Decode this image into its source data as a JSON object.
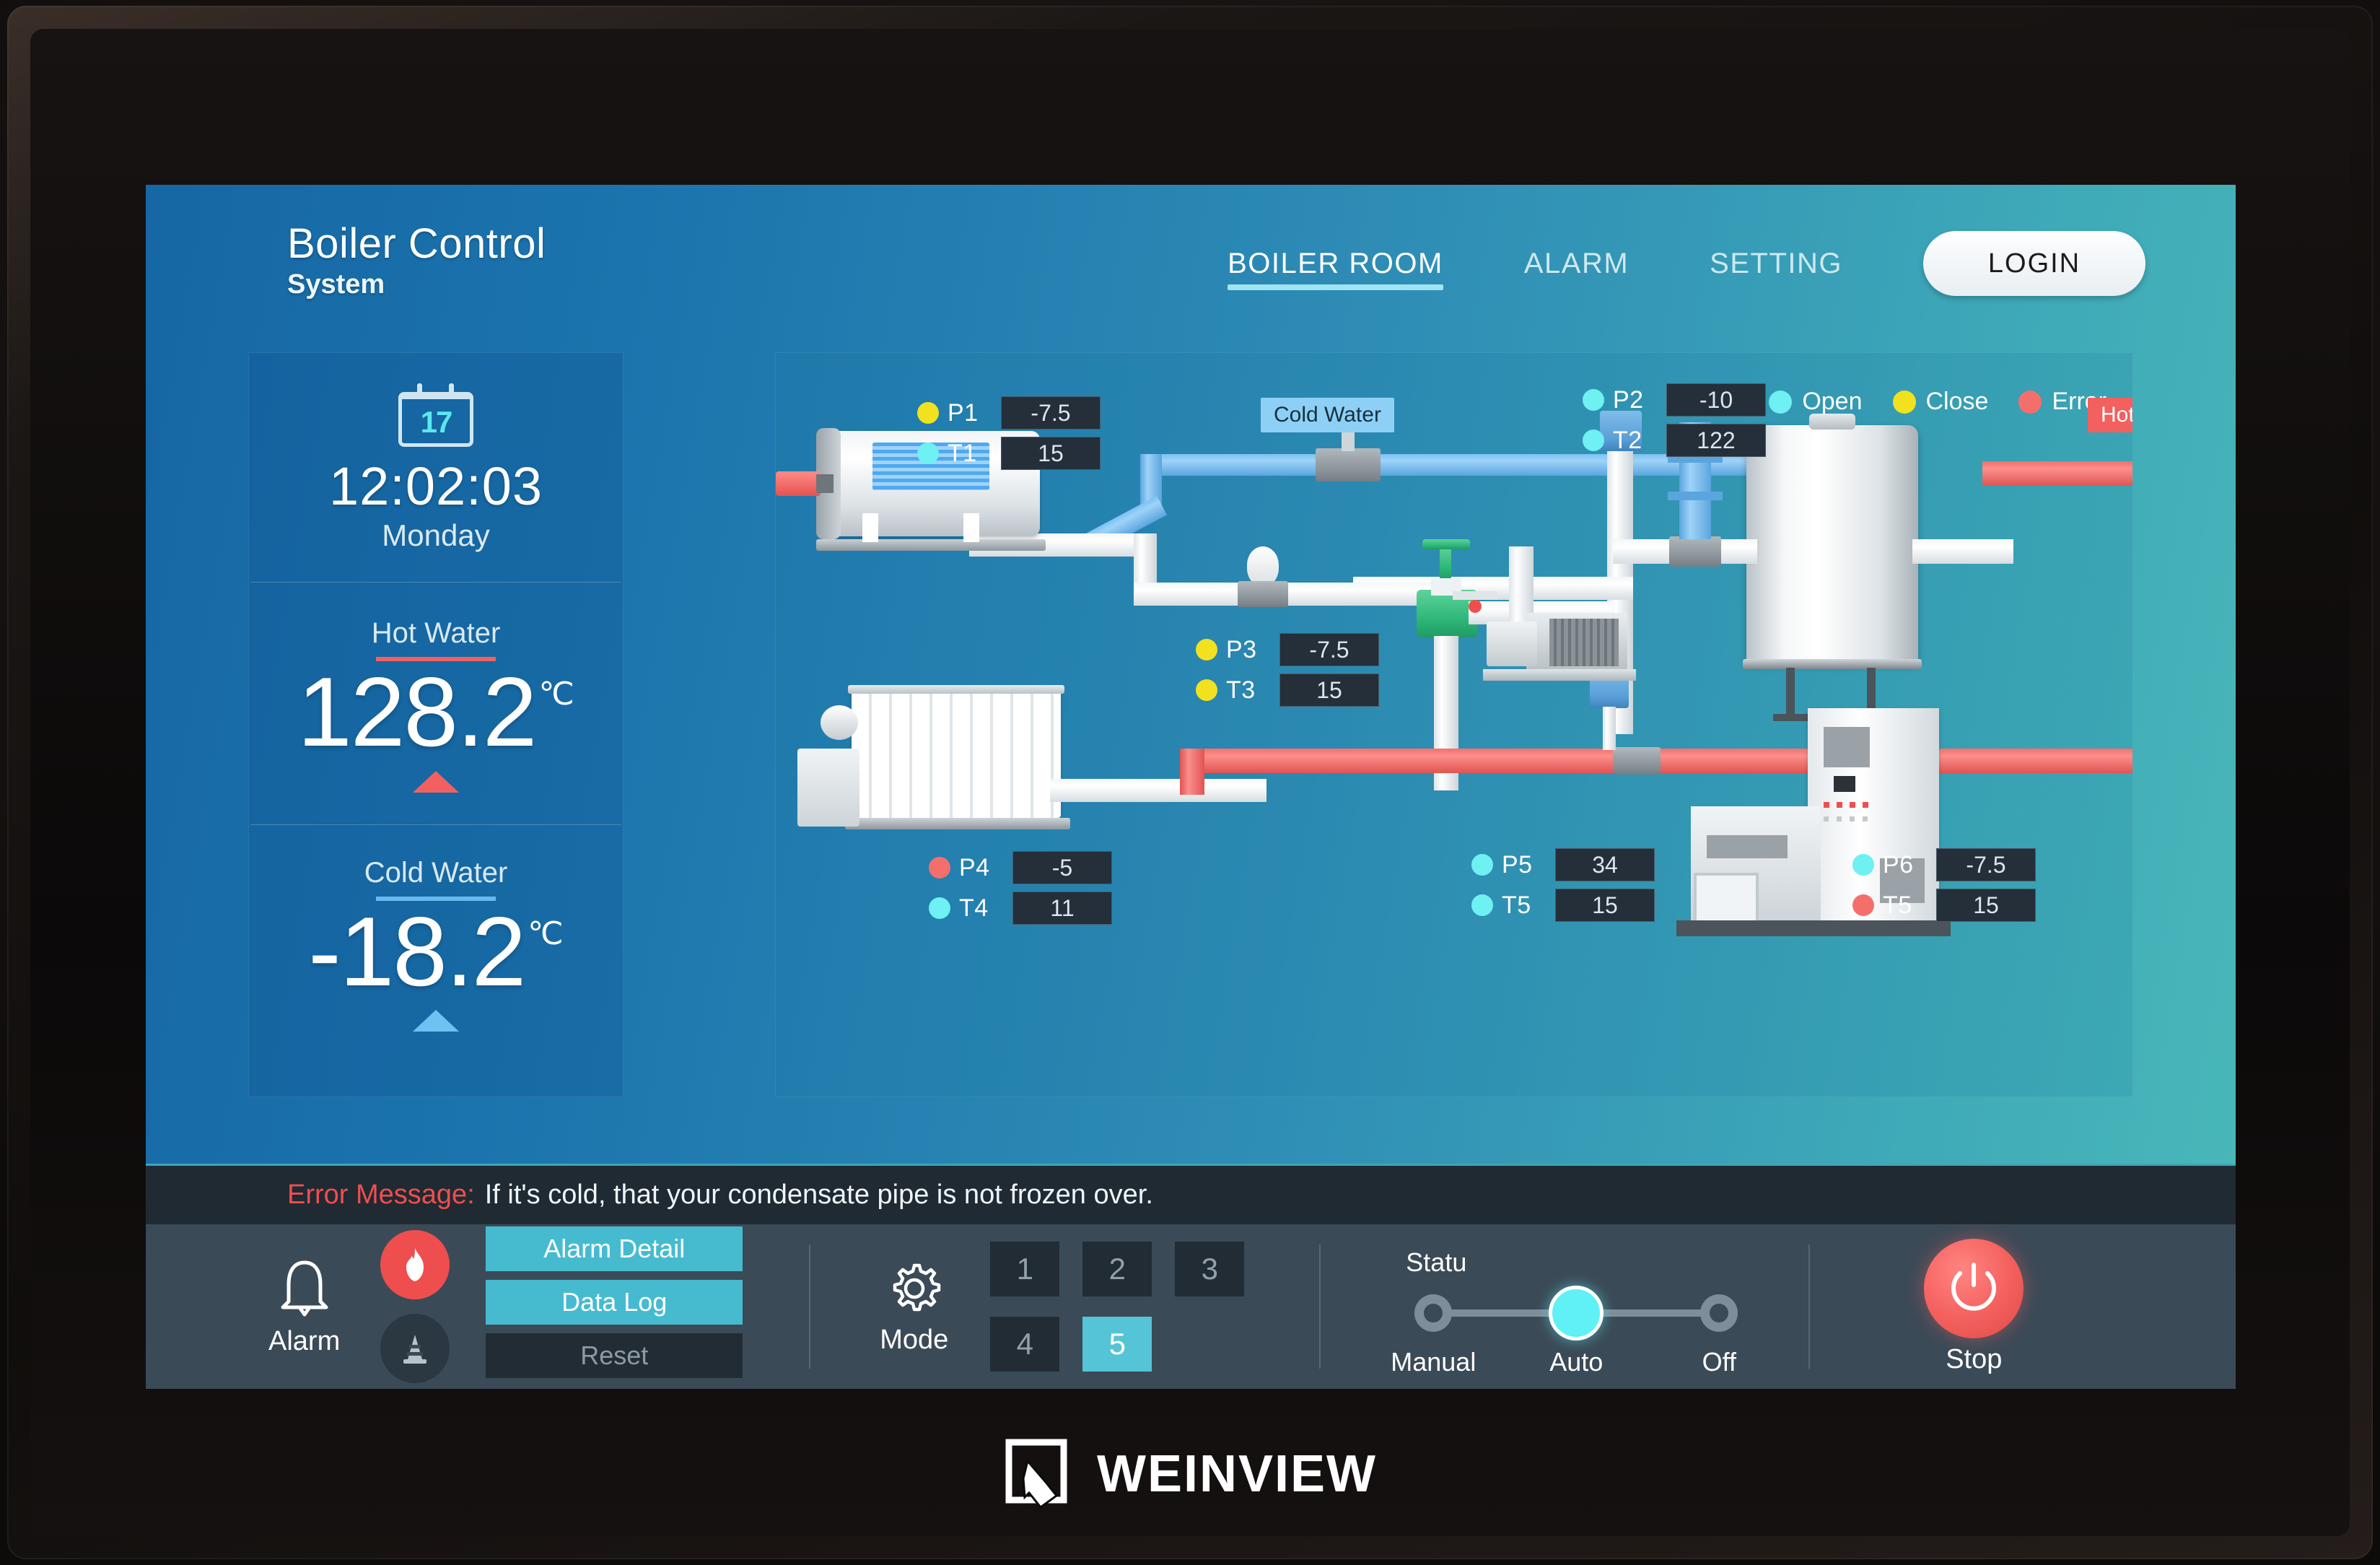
{
  "header": {
    "title": "Boiler Control",
    "subtitle": "System",
    "nav": [
      {
        "label": "BOILER ROOM",
        "active": true
      },
      {
        "label": "ALARM",
        "active": false
      },
      {
        "label": "SETTING",
        "active": false
      }
    ],
    "login_label": "LOGIN"
  },
  "sidebar": {
    "calendar_day": "17",
    "time": "12:02:03",
    "weekday": "Monday",
    "hot": {
      "label": "Hot Water",
      "value": "128.2",
      "unit": "℃",
      "trend": "up",
      "accent": "#f2615f"
    },
    "cold": {
      "label": "Cold Water",
      "value": "-18.2",
      "unit": "℃",
      "trend": "up",
      "accent": "#68b9f0"
    }
  },
  "diagram": {
    "legend": [
      {
        "label": "Open",
        "color": "#6ff0f2"
      },
      {
        "label": "Close",
        "color": "#f2e11f"
      },
      {
        "label": "Error",
        "color": "#f46f6c"
      }
    ],
    "badges": [
      {
        "label": "Cold Water",
        "type": "cold"
      },
      {
        "label": "Hot Water",
        "type": "hot"
      }
    ],
    "tags": [
      {
        "id": "g1",
        "rows": [
          {
            "name": "P1",
            "value": "-7.5",
            "state": "close"
          },
          {
            "name": "T1",
            "value": "15",
            "state": "open"
          }
        ]
      },
      {
        "id": "g2",
        "rows": [
          {
            "name": "P2",
            "value": "-10",
            "state": "open"
          },
          {
            "name": "T2",
            "value": "122",
            "state": "open"
          }
        ]
      },
      {
        "id": "g3",
        "rows": [
          {
            "name": "P3",
            "value": "-7.5",
            "state": "close"
          },
          {
            "name": "T3",
            "value": "15",
            "state": "close"
          }
        ]
      },
      {
        "id": "g4",
        "rows": [
          {
            "name": "P4",
            "value": "-5",
            "state": "error"
          },
          {
            "name": "T4",
            "value": "11",
            "state": "open"
          }
        ]
      },
      {
        "id": "g5",
        "rows": [
          {
            "name": "P5",
            "value": "34",
            "state": "open"
          },
          {
            "name": "T5",
            "value": "15",
            "state": "open"
          }
        ]
      },
      {
        "id": "g6",
        "rows": [
          {
            "name": "P6",
            "value": "-7.5",
            "state": "open"
          },
          {
            "name": "T5",
            "value": "15",
            "state": "error"
          }
        ]
      }
    ]
  },
  "error_bar": {
    "label": "Error Message:",
    "message": "If it's cold, that your condensate pipe is not frozen over."
  },
  "controls": {
    "alarm": {
      "caption": "Alarm",
      "icon": "bell-icon",
      "indicators": [
        {
          "icon": "fire-icon",
          "active": true
        },
        {
          "icon": "cone-icon",
          "active": false
        }
      ],
      "buttons": [
        {
          "label": "Alarm Detail",
          "style": "teal"
        },
        {
          "label": "Data Log",
          "style": "teal"
        },
        {
          "label": "Reset",
          "style": "dark"
        }
      ]
    },
    "mode": {
      "caption": "Mode",
      "icon": "gear-icon",
      "buttons": [
        {
          "label": "1",
          "selected": false
        },
        {
          "label": "2",
          "selected": false
        },
        {
          "label": "3",
          "selected": false
        },
        {
          "label": "4",
          "selected": false
        },
        {
          "label": "5",
          "selected": true
        }
      ]
    },
    "status": {
      "title": "Statu",
      "options": [
        {
          "label": "Manual",
          "active": false
        },
        {
          "label": "Auto",
          "active": true
        },
        {
          "label": "Off",
          "active": false
        }
      ]
    },
    "stop": {
      "caption": "Stop",
      "icon": "power-icon",
      "color": "#f4615e"
    }
  },
  "brand": {
    "name": "WEINVIEW",
    "icon": "weinview-logo-icon"
  }
}
